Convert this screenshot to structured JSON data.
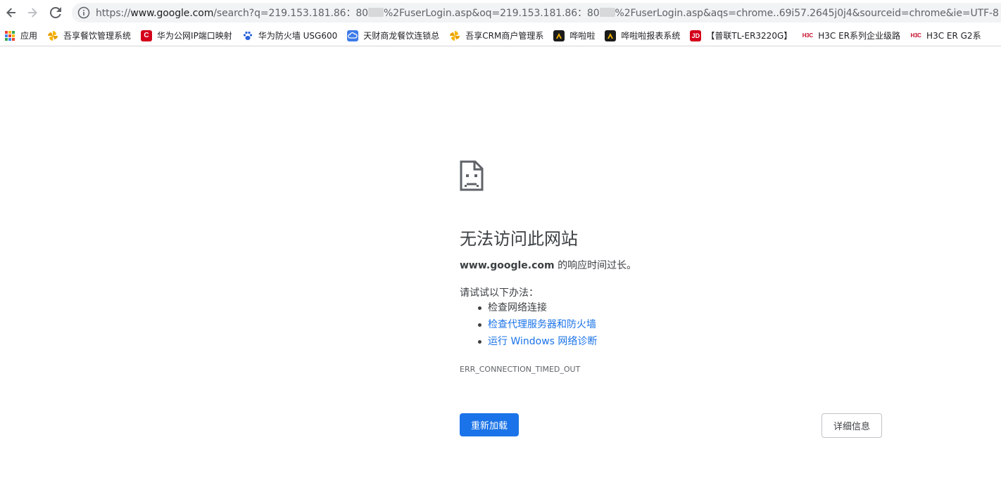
{
  "browser": {
    "url": {
      "scheme": "https://",
      "host": "www.google.com",
      "part1": "/search?q=219.153.181.86：80",
      "part2": "%2FuserLogin.asp&oq=219.153.181.86：80",
      "part3": "%2FuserLogin.asp&aqs=chrome..69i57.2645j0j4&sourceid=chrome&ie=UTF-8"
    }
  },
  "bookmarks": {
    "apps": "应用",
    "items": [
      {
        "label": "吾享餐饮管理系统",
        "icon": "pinwheel-icon"
      },
      {
        "label": "华为公网IP端口映射",
        "icon": "red-c-icon"
      },
      {
        "label": "华为防火墙 USG600",
        "icon": "paw-icon"
      },
      {
        "label": "天财商龙餐饮连锁总",
        "icon": "cloud-icon"
      },
      {
        "label": "吾享CRM商户管理系",
        "icon": "pinwheel-icon"
      },
      {
        "label": "哗啦啦",
        "icon": "hualala-icon"
      },
      {
        "label": "哗啦啦报表系统",
        "icon": "hualala-icon"
      },
      {
        "label": "【普联TL-ER3220G】",
        "icon": "jd-icon"
      },
      {
        "label": "H3C ER系列企业级路",
        "icon": "h3c-icon"
      },
      {
        "label": "H3C ER G2系",
        "icon": "h3c-icon"
      }
    ]
  },
  "error": {
    "title": "无法访问此网站",
    "host": "www.google.com",
    "message": " 的响应时间过长。",
    "try_label": "请试试以下办法：",
    "suggestions": [
      "检查网络连接",
      "检查代理服务器和防火墙",
      "运行 Windows 网络诊断"
    ],
    "code": "ERR_CONNECTION_TIMED_OUT",
    "reload_label": "重新加载",
    "details_label": "详细信息"
  },
  "colors": {
    "accent": "#1a73e8",
    "text": "#3c4043"
  }
}
